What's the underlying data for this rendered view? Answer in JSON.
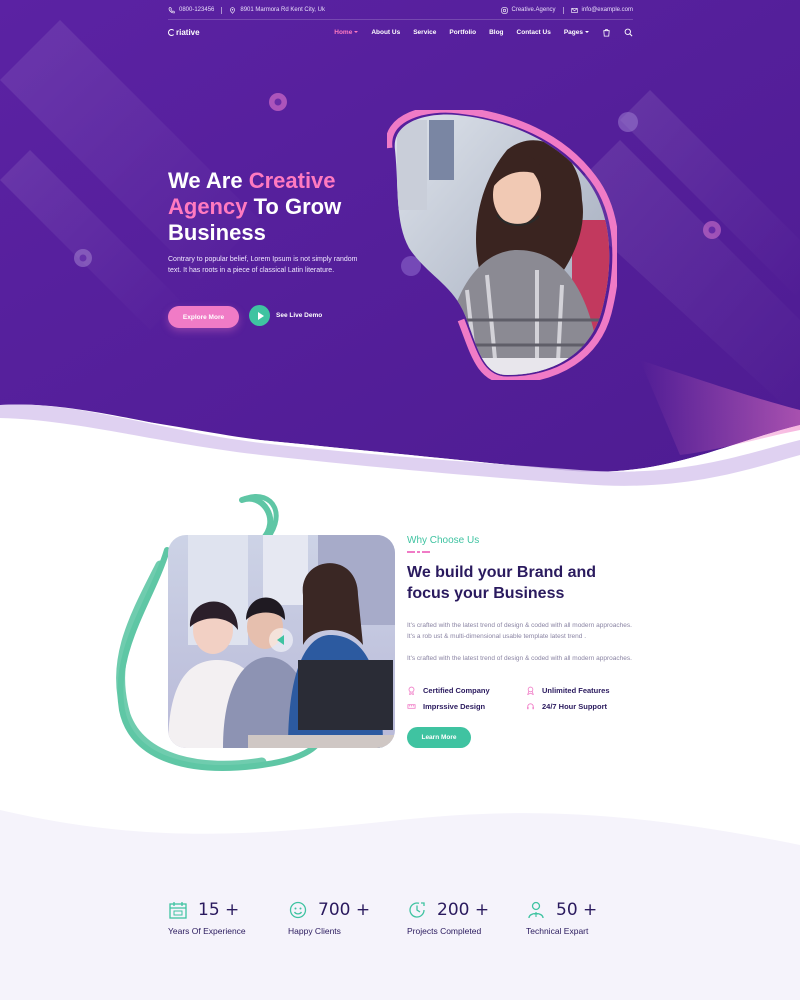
{
  "colors": {
    "primary": "#5a1fa0",
    "pink": "#f07bc6",
    "teal": "#3fc3a1",
    "navy": "#2a1a5e"
  },
  "topbar": {
    "phone_icon": "phone-icon",
    "phone": "0800-123456",
    "location_icon": "location-pin-icon",
    "address": "8901 Marmora Rd Kent City, Uk",
    "instagram_icon": "instagram-icon",
    "instagram": "Creative.Agency",
    "email_icon": "mail-icon",
    "email": "info@example.com"
  },
  "nav": {
    "logo": "riative",
    "items": [
      {
        "label": "Home",
        "has_dropdown": true,
        "active": true
      },
      {
        "label": "About Us"
      },
      {
        "label": "Service"
      },
      {
        "label": "Portfolio"
      },
      {
        "label": "Blog"
      },
      {
        "label": "Contact Us"
      },
      {
        "label": "Pages",
        "has_dropdown": true
      }
    ],
    "cart_icon": "shopping-bag-icon",
    "search_icon": "search-icon"
  },
  "hero": {
    "title_part1": "We Are ",
    "title_accent": "Creative Agency",
    "title_part2": " To Grow Business",
    "description": "Contrary to popular belief, Lorem Ipsum is not simply random text. It has roots in a piece of classical Latin literature.",
    "primary_button": "Explore More",
    "demo_label": "See Live Demo"
  },
  "about": {
    "eyebrow": "Why Choose Us",
    "title": "We build your Brand and focus your Business",
    "para1": "It's crafted with the latest trend of design & coded with all modern approaches. It's a rob ust & multi-dimensional usable template latest trend .",
    "para2": "It's crafted with the latest trend of design & coded with all modern approaches.",
    "features": [
      {
        "label": "Certified Company",
        "icon": "award-icon"
      },
      {
        "label": "Unlimited Features",
        "icon": "medal-icon"
      },
      {
        "label": "Imprssive Design",
        "icon": "design-icon"
      },
      {
        "label": "24/7 Hour Support",
        "icon": "headset-icon"
      }
    ],
    "button": "Learn More"
  },
  "stats": [
    {
      "number": "15",
      "suffix": "+",
      "label": "Years Of Experience",
      "icon": "calendar-icon"
    },
    {
      "number": "700",
      "suffix": "+",
      "label": "Happy Clients",
      "icon": "happy-face-icon"
    },
    {
      "number": "200",
      "suffix": "+",
      "label": "Projects Completed",
      "icon": "clock-check-icon"
    },
    {
      "number": "50",
      "suffix": "+",
      "label": "Technical Expart",
      "icon": "expert-icon"
    }
  ]
}
